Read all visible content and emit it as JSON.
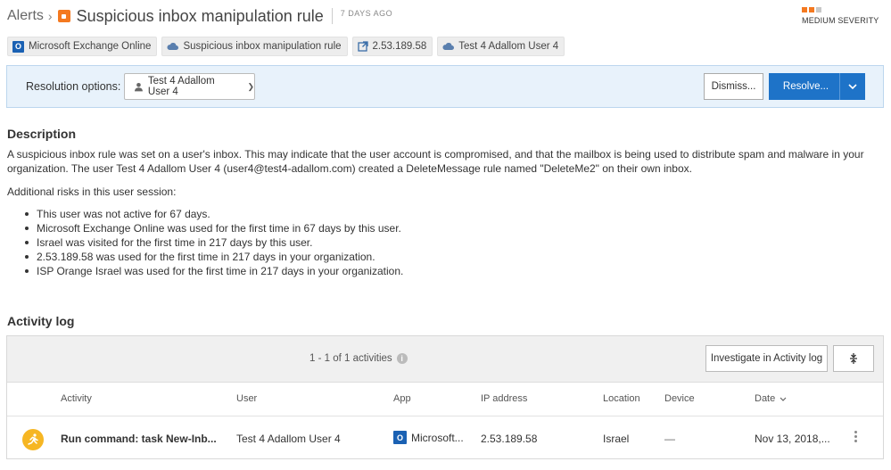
{
  "header": {
    "breadcrumb": "Alerts",
    "breadcrumb_sep": "›",
    "title": "Suspicious inbox manipulation rule",
    "age": "7 DAYS AGO",
    "severity_label": "MEDIUM SEVERITY",
    "severity_colors": [
      "#f47920",
      "#f47920",
      "#c8c8c8"
    ]
  },
  "tags": [
    {
      "icon": "exchange-icon",
      "label": "Microsoft Exchange Online"
    },
    {
      "icon": "cloud-icon",
      "label": "Suspicious inbox manipulation rule"
    },
    {
      "icon": "external-link-icon",
      "label": "2.53.189.58"
    },
    {
      "icon": "cloud-icon",
      "label": "Test 4 Adallom User 4"
    }
  ],
  "resolution": {
    "label": "Resolution options:",
    "user": "Test 4 Adallom User 4",
    "dismiss": "Dismiss...",
    "resolve": "Resolve..."
  },
  "description": {
    "heading": "Description",
    "text": "A suspicious inbox rule was set on a user's inbox. This may indicate that the user account is compromised, and that the mailbox is being used to distribute spam and malware in your organization. The user Test 4 Adallom User 4 (user4@test4-adallom.com) created a DeleteMessage rule named \"DeleteMe2\" on their own inbox.",
    "additional": "Additional risks in this user session:",
    "risks": [
      "This user was not active for 67 days.",
      "Microsoft Exchange Online was used for the first time in 67 days by this user.",
      "Israel was visited for the first time in 217 days by this user.",
      "2.53.189.58 was used for the first time in 217 days in your organization.",
      "ISP Orange Israel was used for the first time in 217 days in your organization."
    ]
  },
  "activity": {
    "heading": "Activity log",
    "count": "1 - 1 of 1 activities",
    "investigate": "Investigate in Activity log",
    "columns": {
      "activity": "Activity",
      "user": "User",
      "app": "App",
      "ip": "IP address",
      "location": "Location",
      "device": "Device",
      "date": "Date"
    },
    "rows": [
      {
        "activity": "Run command: task New-Inb...",
        "user": "Test 4 Adallom User 4",
        "app": "Microsoft...",
        "ip": "2.53.189.58",
        "location": "Israel",
        "device": "—",
        "date": "Nov 13, 2018,..."
      }
    ]
  }
}
